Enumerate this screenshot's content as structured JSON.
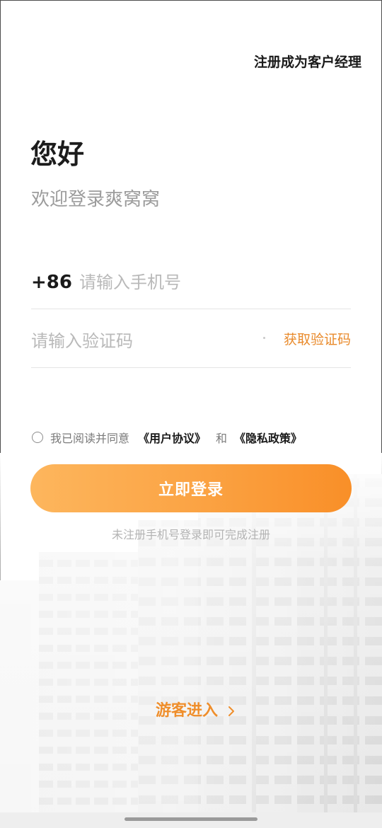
{
  "header": {
    "register_manager_link": "注册成为客户经理"
  },
  "greeting": {
    "title": "您好",
    "subtitle": "欢迎登录爽窝窝"
  },
  "phone": {
    "country_code": "+86",
    "placeholder": "请输入手机号",
    "value": ""
  },
  "code": {
    "placeholder": "请输入验证码",
    "value": "",
    "get_code_label": "获取验证码"
  },
  "agreement": {
    "checked": false,
    "prefix": "我已阅读并同意",
    "user_agreement": "《用户协议》",
    "conjunction": "和",
    "privacy_policy": "《隐私政策》"
  },
  "login": {
    "button_label": "立即登录",
    "hint": "未注册手机号登录即可完成注册"
  },
  "guest": {
    "label": "游客进入",
    "icon": "chevron-right-icon"
  },
  "colors": {
    "accent": "#ef8e2b",
    "button_gradient_start": "#fdb65d",
    "button_gradient_end": "#f98f28",
    "text_primary": "#1a1a1a",
    "text_placeholder": "#b9b9b9",
    "background": "#ffffff"
  }
}
